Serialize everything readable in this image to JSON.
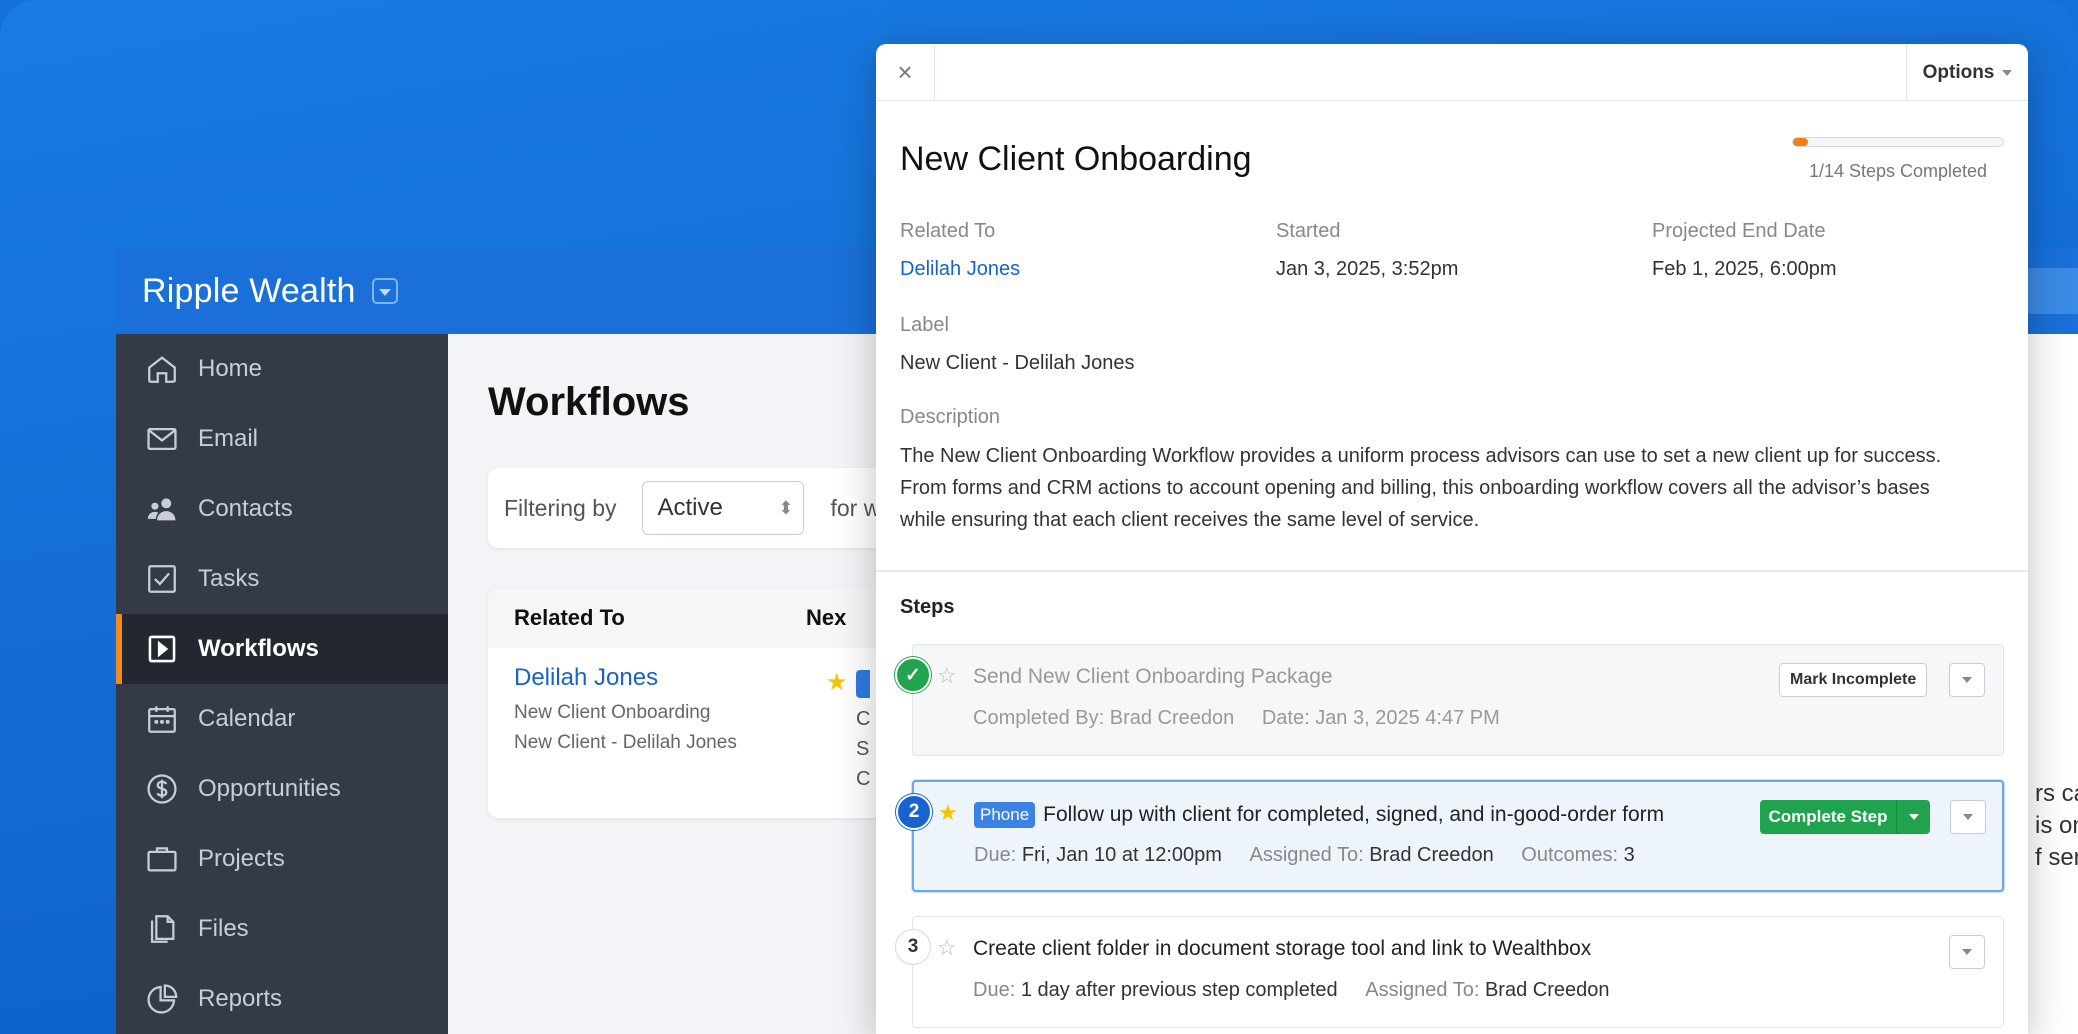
{
  "app": {
    "brand": "Ripple Wealth",
    "nav": [
      {
        "label": "Home",
        "icon": "home-icon"
      },
      {
        "label": "Email",
        "icon": "mail-icon"
      },
      {
        "label": "Contacts",
        "icon": "contacts-icon"
      },
      {
        "label": "Tasks",
        "icon": "checkbox-icon"
      },
      {
        "label": "Workflows",
        "icon": "play-square-icon",
        "active": true
      },
      {
        "label": "Calendar",
        "icon": "calendar-icon"
      },
      {
        "label": "Opportunities",
        "icon": "dollar-icon"
      },
      {
        "label": "Projects",
        "icon": "briefcase-icon"
      },
      {
        "label": "Files",
        "icon": "files-icon"
      },
      {
        "label": "Reports",
        "icon": "pie-chart-icon"
      }
    ],
    "main": {
      "title": "Workflows",
      "filter_label": "Filtering by",
      "filter_value": "Active",
      "filter_for": "for w",
      "table": {
        "col_related": "Related To",
        "col_next": "Nex",
        "row": {
          "name": "Delilah Jones",
          "line1": "New Client Onboarding",
          "line2": "New Client - Delilah Jones",
          "frag1": "C",
          "frag2": "S",
          "frag3": "C"
        }
      },
      "right_frags": [
        "rs ca",
        "is onl",
        "f serv"
      ]
    }
  },
  "panel": {
    "close": "×",
    "options": "Options",
    "title": "New Client Onboarding",
    "progress": {
      "completed": 1,
      "total": 14,
      "text": "1/14 Steps Completed",
      "color": "#f07f16"
    },
    "related_to_label": "Related To",
    "related_to_value": "Delilah Jones",
    "started_label": "Started",
    "started_value": "Jan 3, 2025, 3:52pm",
    "end_label": "Projected End Date",
    "end_value": "Feb 1, 2025, 6:00pm",
    "label_label": "Label",
    "label_value": "New Client - Delilah Jones",
    "description_label": "Description",
    "description_value": "The New Client Onboarding Workflow provides a uniform process advisors can use to set a new client up for success. From forms and CRM actions to account opening and billing, this onboarding workflow covers all the advisor’s bases while ensuring that each client receives the same level of service.",
    "steps_title": "Steps",
    "steps": [
      {
        "num": "✓",
        "title": "Send New Client Onboarding Package",
        "meta1_label": "Completed By: ",
        "meta1_value": "Brad Creedon",
        "meta2_label": "Date: ",
        "meta2_value": "Jan 3, 2025 4:47 PM",
        "action": "Mark Incomplete"
      },
      {
        "num": "2",
        "badge": "Phone",
        "title": "Follow up with client for completed, signed, and in-good-order form",
        "meta1_label": "Due: ",
        "meta1_value": "Fri, Jan 10 at 12:00pm",
        "meta2_label": "Assigned To: ",
        "meta2_value": "Brad Creedon",
        "meta3_label": "Outcomes: ",
        "meta3_value": "3",
        "action": "Complete Step"
      },
      {
        "num": "3",
        "title": "Create client folder in document storage tool and link to Wealthbox",
        "meta1_label": "Due: ",
        "meta1_value": "1 day after previous step completed",
        "meta2_label": "Assigned To: ",
        "meta2_value": "Brad Creedon"
      }
    ]
  }
}
